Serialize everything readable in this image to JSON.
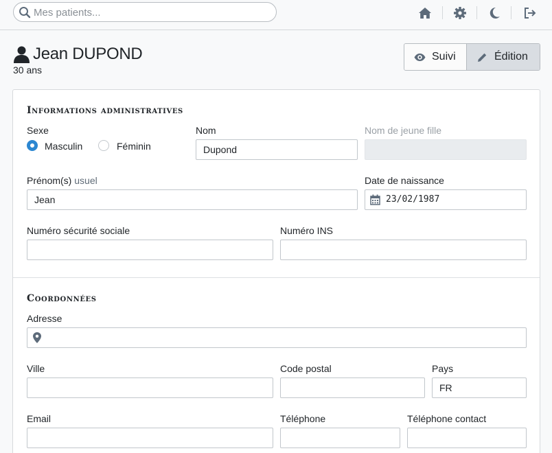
{
  "navbar": {
    "search_placeholder": "Mes patients...",
    "icons": [
      "home-icon",
      "gear-icon",
      "moon-icon",
      "logout-icon"
    ]
  },
  "patient": {
    "name": "Jean DUPOND",
    "age": "30 ans"
  },
  "modes": {
    "suivi_label": "Suivi",
    "edition_label": "Édition",
    "active": "edition"
  },
  "admin": {
    "title": "Informations administratives",
    "sexe_label": "Sexe",
    "sexe_options": [
      "Masculin",
      "Féminin"
    ],
    "sexe_selected": "Masculin",
    "nom_label": "Nom",
    "nom_value": "Dupond",
    "nom_jeune_fille_label": "Nom de jeune fille",
    "prenom_label": "Prénom(s)",
    "prenom_sub": "usuel",
    "prenom_value": "Jean",
    "naissance_label": "Date de naissance",
    "naissance_value": "23/02/1987",
    "nss_label": "Numéro sécurité sociale",
    "ins_label": "Numéro INS"
  },
  "coordonnees": {
    "title": "Coordonnées",
    "adresse_label": "Adresse",
    "ville_label": "Ville",
    "cp_label": "Code postal",
    "pays_label": "Pays",
    "pays_value": "FR",
    "email_label": "Email",
    "tel_label": "Téléphone",
    "tel_contact_label": "Téléphone contact"
  },
  "colors": {
    "accent": "#2c87d1",
    "icon": "#5d6b7a",
    "active_button": "#d9dde2"
  }
}
